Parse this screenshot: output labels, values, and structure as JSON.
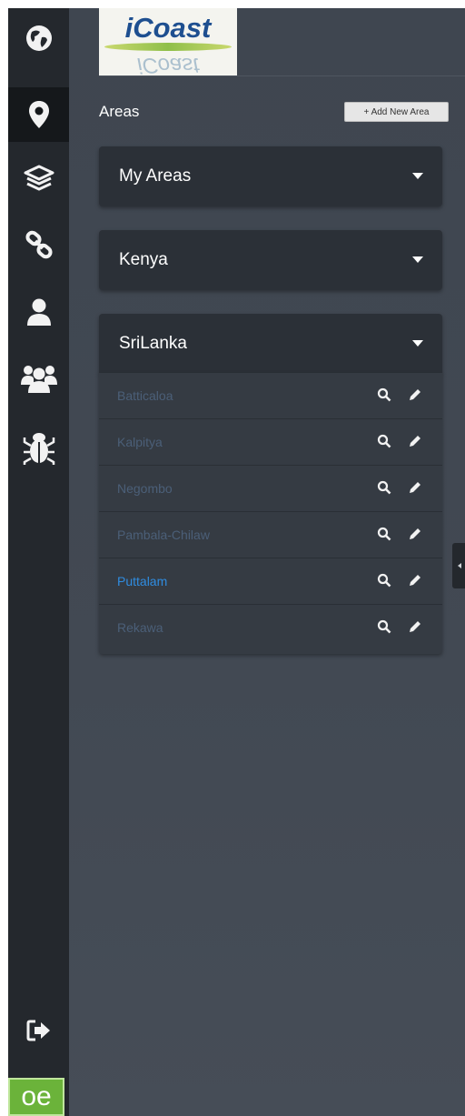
{
  "logo": {
    "title": "iCoast",
    "reflection": "iCoast"
  },
  "rail": {
    "items": [
      {
        "icon": "globe-icon"
      },
      {
        "icon": "map-marker-icon",
        "active": true
      },
      {
        "icon": "layers-icon"
      },
      {
        "icon": "link-icon"
      },
      {
        "icon": "user-icon"
      },
      {
        "icon": "users-icon"
      },
      {
        "icon": "bug-icon"
      }
    ],
    "logout_icon": "sign-out-icon",
    "brand": "oe"
  },
  "areas": {
    "title": "Areas",
    "add_label": "+ Add New Area",
    "groups": [
      {
        "label": "My Areas",
        "expanded": false
      },
      {
        "label": "Kenya",
        "expanded": false
      },
      {
        "label": "SriLanka",
        "expanded": true,
        "items": [
          {
            "label": "Batticaloa"
          },
          {
            "label": "Kalpitya"
          },
          {
            "label": "Negombo"
          },
          {
            "label": "Pambala-Chilaw"
          },
          {
            "label": "Puttalam",
            "active": true
          },
          {
            "label": "Rekawa"
          }
        ]
      }
    ]
  },
  "colors": {
    "rail_bg": "#24282d",
    "panel_bg": "#424953",
    "header_bg": "#2b3037",
    "link_active": "#2f8ce0",
    "link_inactive": "#4b5f78",
    "brand_green": "#6bb33a"
  }
}
